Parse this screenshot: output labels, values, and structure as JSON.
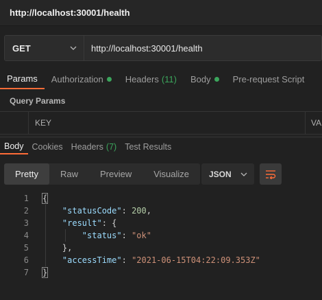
{
  "window": {
    "title": "http://localhost:30001/health"
  },
  "request": {
    "method": "GET",
    "url": "http://localhost:30001/health",
    "tabs": {
      "params": "Params",
      "authorization": "Authorization",
      "headers": "Headers",
      "headers_count": "(11)",
      "body": "Body",
      "prerequest": "Pre-request Script"
    },
    "query_params_label": "Query Params",
    "table": {
      "key_header": "KEY",
      "value_header": "VA"
    }
  },
  "response": {
    "tabs": {
      "body": "Body",
      "cookies": "Cookies",
      "headers": "Headers",
      "headers_count": "(7)",
      "test_results": "Test Results"
    },
    "views": [
      "Pretty",
      "Raw",
      "Preview",
      "Visualize"
    ],
    "format": "JSON",
    "line_numbers": [
      "1",
      "2",
      "3",
      "4",
      "5",
      "6",
      "7"
    ],
    "json": {
      "key_statusCode": "\"statusCode\"",
      "val_statusCode": "200",
      "key_result": "\"result\"",
      "key_status": "\"status\"",
      "val_status": "\"ok\"",
      "key_accessTime": "\"accessTime\"",
      "val_accessTime": "\"2021-06-15T04:22:09.353Z\""
    }
  },
  "colors": {
    "accent": "#ff6c37",
    "status_dot": "#3ba55c"
  }
}
